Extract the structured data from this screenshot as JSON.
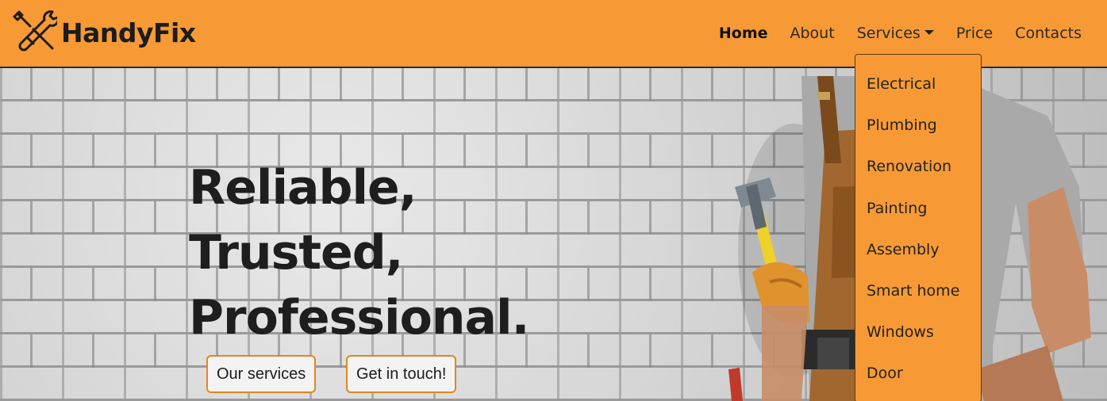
{
  "brand": {
    "name": "HandyFix",
    "icon": "tools-icon"
  },
  "nav": {
    "items": [
      {
        "label": "Home",
        "active": true
      },
      {
        "label": "About"
      },
      {
        "label": "Services",
        "has_dropdown": true
      },
      {
        "label": "Price"
      },
      {
        "label": "Contacts"
      }
    ]
  },
  "services_menu": {
    "items": [
      "Electrical",
      "Plumbing",
      "Renovation",
      "Painting",
      "Assembly",
      "Smart home",
      "Windows",
      "Door"
    ]
  },
  "hero": {
    "title_lines": [
      "Reliable,",
      "Trusted,",
      "Professional."
    ],
    "buttons": {
      "services": "Our services",
      "contact": "Get in touch!"
    }
  },
  "colors": {
    "accent": "#f79a35",
    "button_border": "#e2871f",
    "text": "#1e1e1e"
  }
}
